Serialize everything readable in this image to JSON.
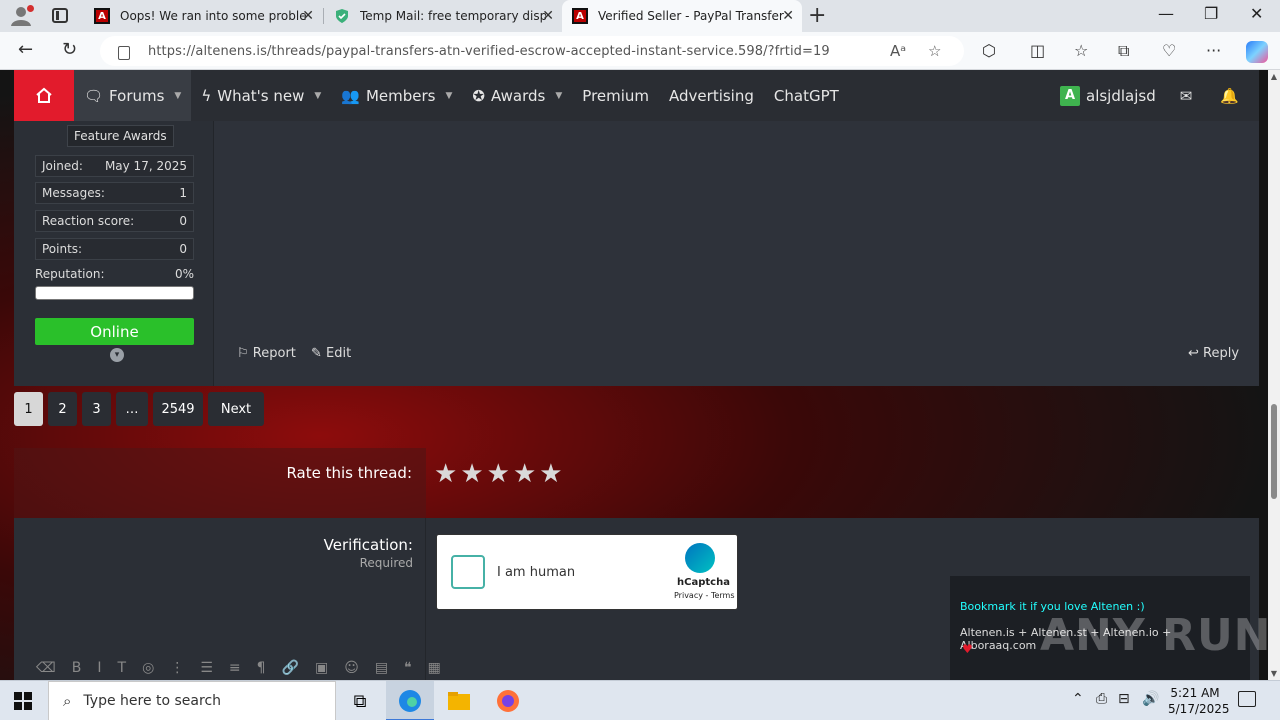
{
  "browser": {
    "tabs": [
      {
        "title": "Oops! We ran into some problems",
        "favicon": "altenen-icon"
      },
      {
        "title": "Temp Mail: free temporary dispo...",
        "favicon": "tempmail-shield-icon"
      },
      {
        "title": "Verified Seller - PayPal Transfers -",
        "favicon": "altenen-icon"
      }
    ],
    "url": "https://altenens.is/threads/paypal-transfers-atn-verified-escrow-accepted-instant-service.598/?frtid=19"
  },
  "nav": {
    "items": [
      {
        "label": "Forums"
      },
      {
        "label": "What's new"
      },
      {
        "label": "Members"
      },
      {
        "label": "Awards"
      },
      {
        "label": "Premium"
      },
      {
        "label": "Advertising"
      },
      {
        "label": "ChatGPT"
      }
    ],
    "user": {
      "initial": "A",
      "name": "alsjdlajsd"
    }
  },
  "userinfo": {
    "award_label": "Feature Awards",
    "stats": [
      {
        "label": "Joined:",
        "value": "May 17, 2025"
      },
      {
        "label": "Messages:",
        "value": "1"
      },
      {
        "label": "Reaction score:",
        "value": "0"
      },
      {
        "label": "Points:",
        "value": "0"
      }
    ],
    "reputation_label": "Reputation:",
    "reputation_value": "0%",
    "reputation_fraction": 0,
    "status": "Online"
  },
  "post_actions": {
    "report": "Report",
    "edit": "Edit",
    "reply": "Reply"
  },
  "pagination": {
    "pages": [
      "1",
      "2",
      "3",
      "…",
      "2549"
    ],
    "next": "Next",
    "current": "1"
  },
  "rating": {
    "label": "Rate this thread:",
    "stars": 5
  },
  "form": {
    "verification_label": "Verification:",
    "required_label": "Required",
    "captcha_text": "I am human",
    "captcha_brand": "hCaptcha",
    "captcha_terms": "Privacy - Terms"
  },
  "popup": {
    "headline": "Bookmark it if you love Altenen :)",
    "body": "Altenen.is + Altenen.st + Altenen.io + Alboraaq.com"
  },
  "watermark": "ANY RUN",
  "taskbar": {
    "search_placeholder": "Type here to search",
    "time": "5:21 AM",
    "date": "5/17/2025"
  }
}
